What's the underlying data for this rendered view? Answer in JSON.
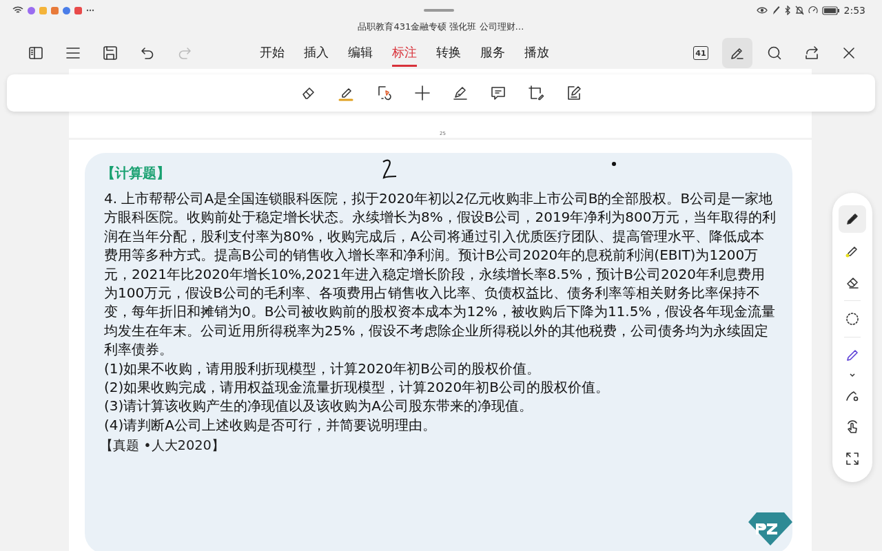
{
  "status_bar": {
    "time": "2:53"
  },
  "document": {
    "title": "品职教育431金融专硕 强化班 公司理财…"
  },
  "menu_bar": {
    "redo": {
      "disabled": true
    },
    "page_count": "41",
    "tabs": [
      {
        "label": "开始",
        "selected": false
      },
      {
        "label": "插入",
        "selected": false
      },
      {
        "label": "编辑",
        "selected": false
      },
      {
        "label": "标注",
        "selected": true
      },
      {
        "label": "转换",
        "selected": false
      },
      {
        "label": "服务",
        "selected": false
      },
      {
        "label": "播放",
        "selected": false
      }
    ]
  },
  "tool_rail": [
    {
      "kind": "pencil",
      "selected": true
    },
    {
      "kind": "highlighter",
      "selected": false
    },
    {
      "kind": "eraser",
      "selected": false
    },
    {
      "kind": "lasso",
      "selected": false
    },
    {
      "kind": "pen",
      "selected": false
    },
    {
      "kind": "shape",
      "selected": false
    },
    {
      "kind": "hand",
      "selected": false
    },
    {
      "kind": "fullscreen",
      "selected": false
    }
  ],
  "page": {
    "page_number": "25",
    "heading": "【计算题】",
    "problem": "4. 上市帮帮公司A是全国连锁眼科医院，拟于2020年初以2亿元收购非上市公司B的全部股权。B公司是一家地方眼科医院。收购前处于稳定增长状态。永续增长为8%，假设B公司，2019年净利为800万元，当年取得的利润在当年分配，股利支付率为80%，收购完成后，A公司将通过引入优质医疗团队、提高管理水平、降低成本费用等多种方式。提高B公司的销售收入增长率和净利润。预计B公司2020年的息税前利润(EBIT)为1200万元，2021年比2020年增长10%,2021年进入稳定增长阶段，永续增长率8.5%，预计B公司2020年利息费用为100万元，假设B公司的毛利率、各项费用占销售收入比率、负债权益比、债务利率等相关财务比率保持不变，每年折旧和摊销为0。B公司被收购前的股权资本成本为12%，被收购后下降为11.5%，假设各年现金流量均发生在年末。公司近用所得税率为25%，假设不考虑除企业所得税以外的其他税费，公司债务均为永续固定利率债券。",
    "questions": [
      "(1)如果不收购，请用股利折现模型，计算2020年初B公司的股权价值。",
      "(2)如果收购完成，请用权益现金流量折现模型，计算2020年初B公司的股权价值。",
      "(3)请计算该收购产生的净现值以及该收购为A公司股东带来的净现值。",
      "(4)请判断A公司上述收购是否可行，并简要说明理由。"
    ],
    "source": "【真题 •人大2020】"
  }
}
